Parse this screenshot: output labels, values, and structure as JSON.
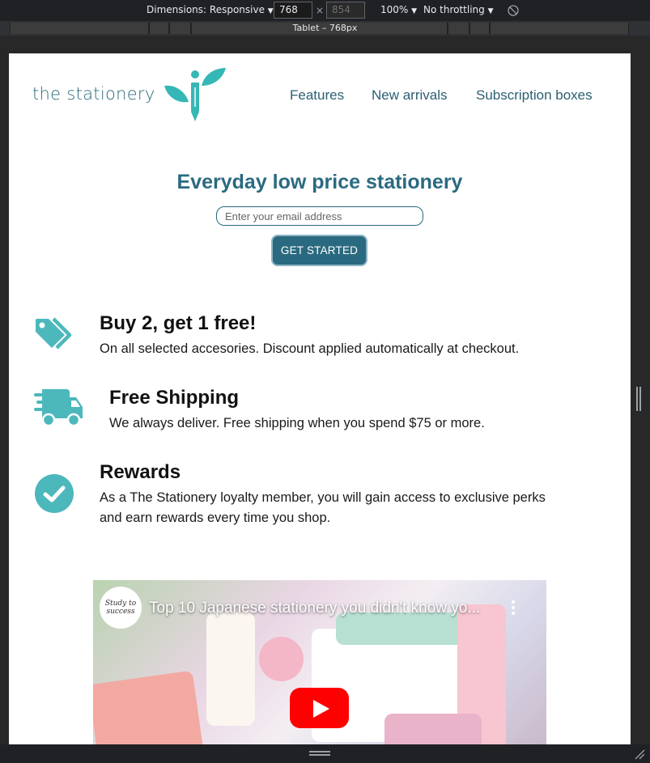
{
  "devtools": {
    "dimensions_label": "Dimensions: Responsive",
    "width_value": "768",
    "times_sign": "×",
    "height_value": "854",
    "zoom": "100%",
    "throttling": "No throttling",
    "device_label": "Tablet – 768px",
    "caret": "▼"
  },
  "site": {
    "logo_text": "the stationery",
    "nav": [
      "Features",
      "New arrivals",
      "Subscription boxes"
    ],
    "headline": "Everyday low price stationery",
    "email_placeholder": "Enter your email address",
    "cta_label": "GET STARTED",
    "features": [
      {
        "icon": "tags-icon",
        "title": "Buy 2, get 1 free!",
        "text": "On all selected accesories. Discount applied automatically at checkout."
      },
      {
        "icon": "shipping-truck-icon",
        "title": "Free Shipping",
        "text": "We always deliver. Free shipping when you spend $75 or more."
      },
      {
        "icon": "check-circle-icon",
        "title": "Rewards",
        "text": "As a The Stationery loyalty member, you will gain access to exclusive perks and earn rewards every time you shop."
      }
    ],
    "video": {
      "title": "Top 10 Japanese stationery you didn't know yo...",
      "channel": "Study to success"
    }
  },
  "colors": {
    "brand": "#2a6a80",
    "icon_teal": "#4cb8bc",
    "youtube_red": "#ff0000"
  }
}
